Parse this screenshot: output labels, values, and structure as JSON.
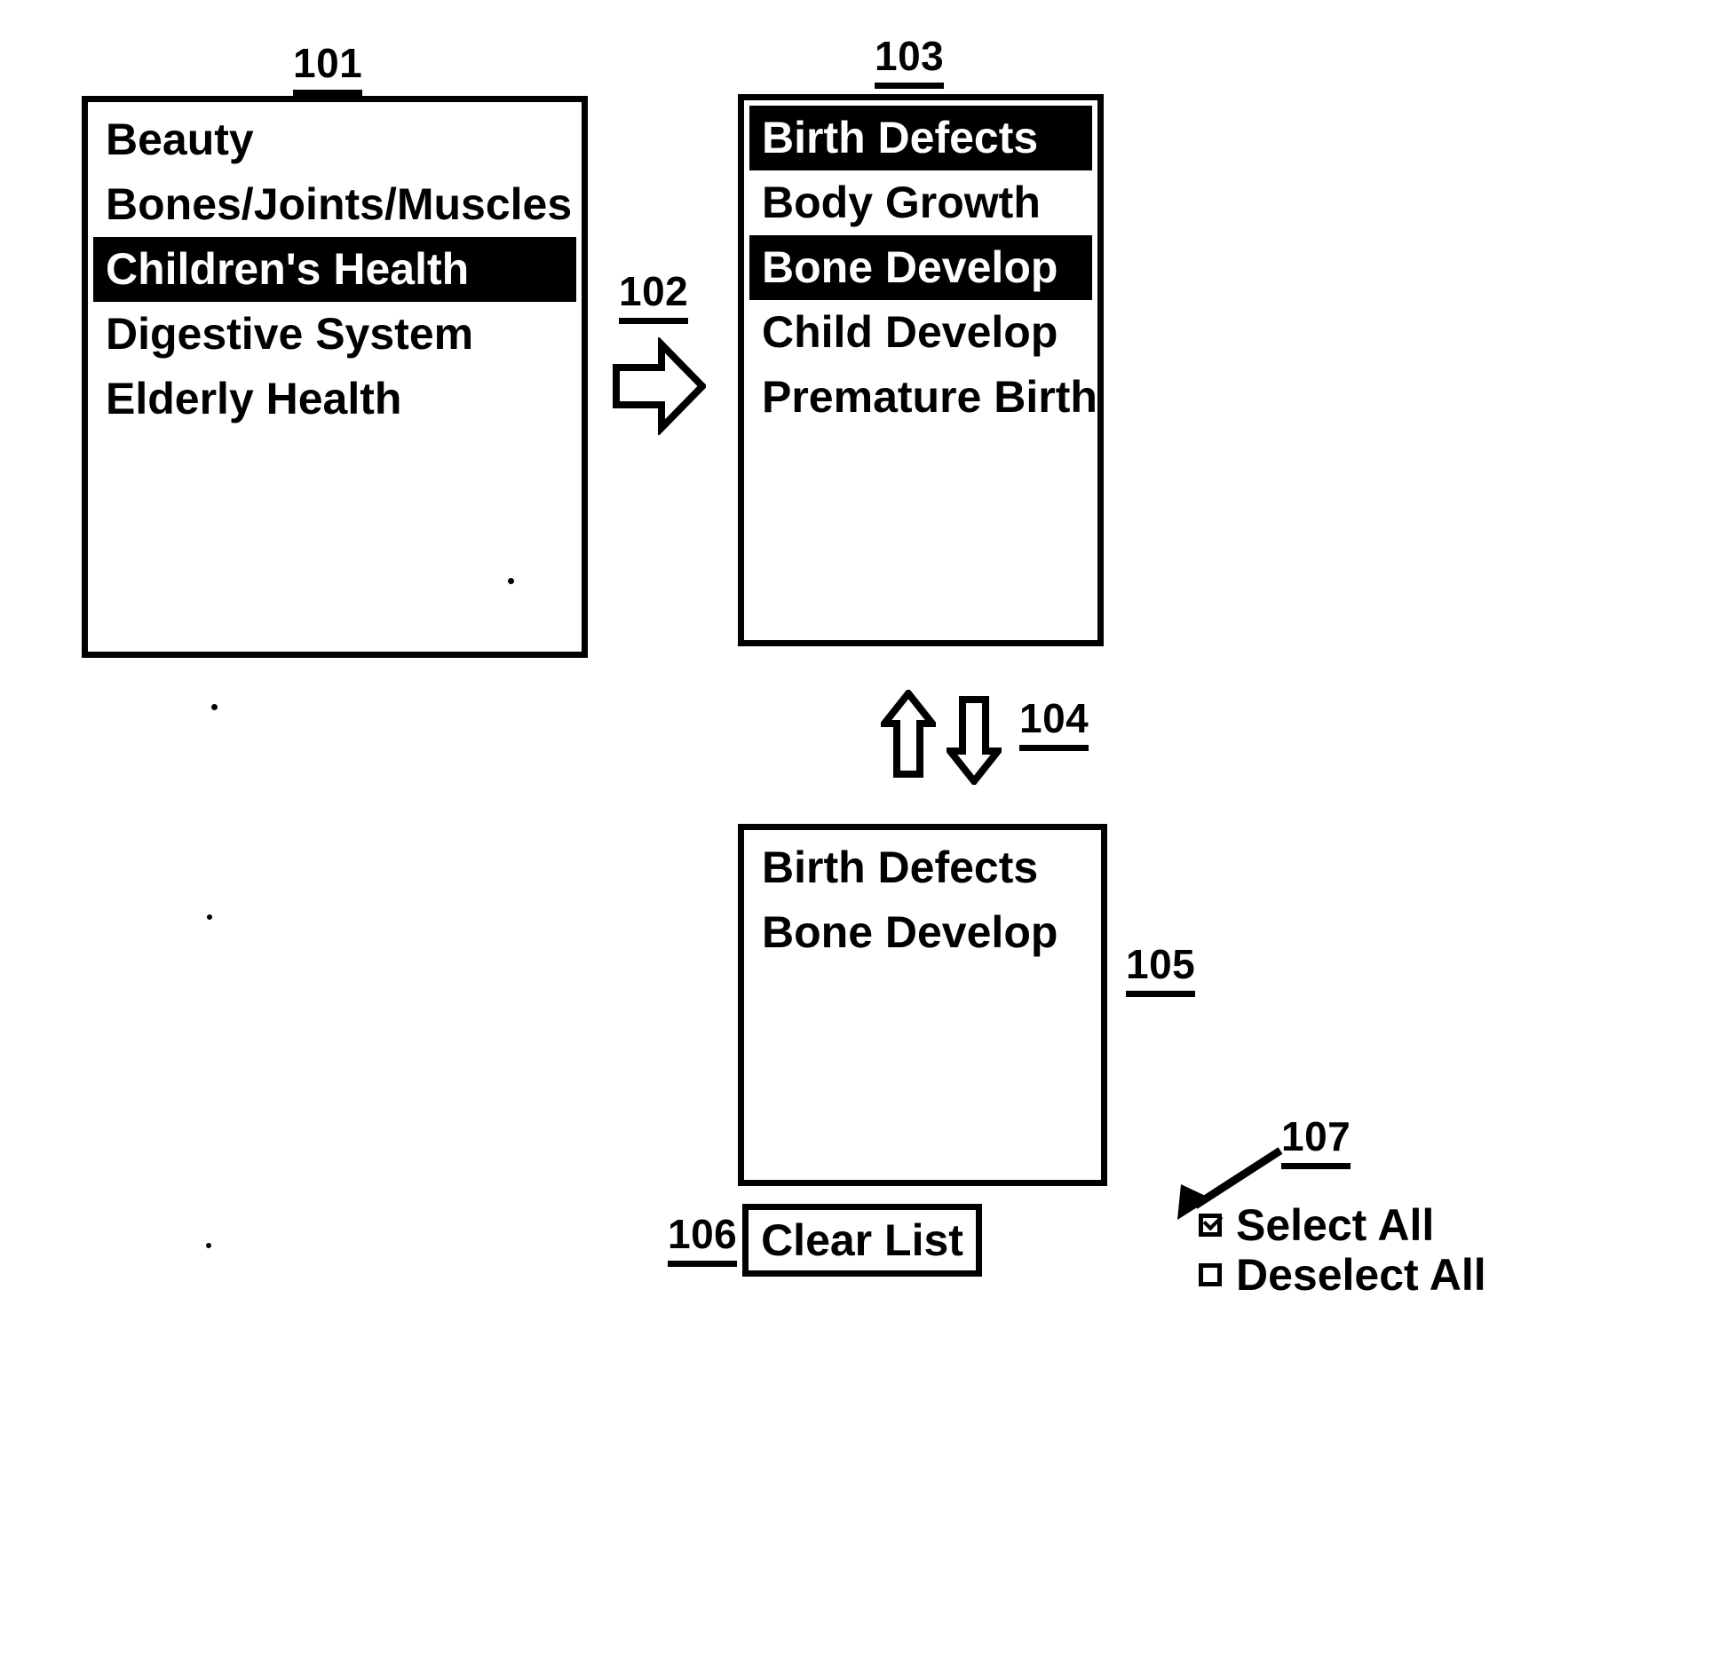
{
  "figure": {
    "callouts": {
      "source_list": "101",
      "transfer_arrow": "102",
      "subtopic_list": "103",
      "move_arrows": "104",
      "selection_list": "105",
      "clear_button": "106",
      "select_controls": "107"
    }
  },
  "source_list": {
    "ref": "101",
    "items": [
      {
        "label": "Beauty",
        "selected": false
      },
      {
        "label": "Bones/Joints/Muscles",
        "selected": false
      },
      {
        "label": "Children's Health",
        "selected": true
      },
      {
        "label": "Digestive System",
        "selected": false
      },
      {
        "label": "Elderly Health",
        "selected": false
      }
    ]
  },
  "transfer_arrow": {
    "ref": "102",
    "icon": "block-arrow-right-icon"
  },
  "subtopic_list": {
    "ref": "103",
    "items": [
      {
        "label": "Birth Defects",
        "selected": true
      },
      {
        "label": "Body Growth",
        "selected": false
      },
      {
        "label": "Bone Develop",
        "selected": true
      },
      {
        "label": "Child Develop",
        "selected": false
      },
      {
        "label": "Premature Birth",
        "selected": false
      }
    ]
  },
  "move_arrows": {
    "ref": "104",
    "up_icon": "block-arrow-up-icon",
    "down_icon": "block-arrow-down-icon"
  },
  "selection_list": {
    "ref": "105",
    "items": [
      {
        "label": "Birth Defects",
        "selected": false
      },
      {
        "label": "Bone Develop",
        "selected": false
      }
    ]
  },
  "clear_button": {
    "ref": "106",
    "label": "Clear List"
  },
  "select_controls": {
    "ref": "107",
    "options": [
      {
        "label": "Select All",
        "checked": true
      },
      {
        "label": "Deselect All",
        "checked": false
      }
    ]
  },
  "colors": {
    "ink": "#000000",
    "paper": "#ffffff",
    "highlight_bg": "#000000",
    "highlight_fg": "#ffffff"
  }
}
